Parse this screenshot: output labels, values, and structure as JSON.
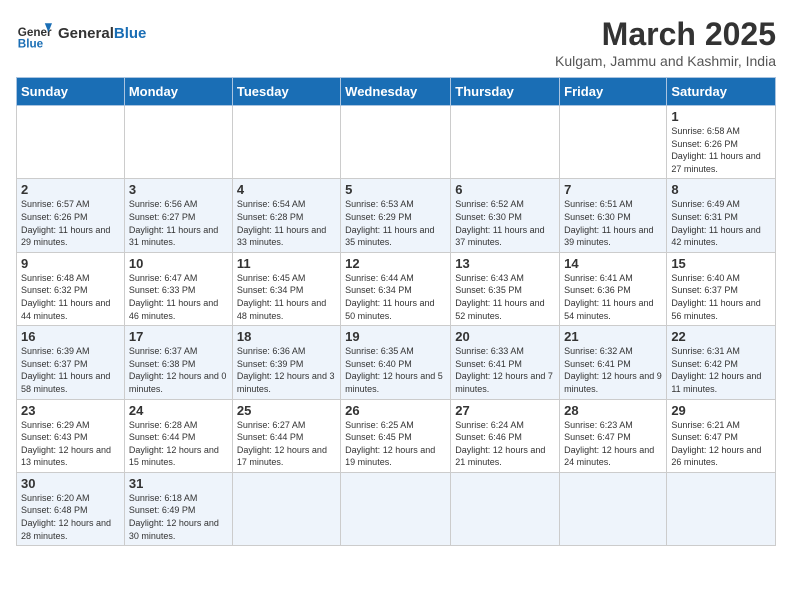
{
  "header": {
    "logo_general": "General",
    "logo_blue": "Blue",
    "month_title": "March 2025",
    "location": "Kulgam, Jammu and Kashmir, India"
  },
  "weekdays": [
    "Sunday",
    "Monday",
    "Tuesday",
    "Wednesday",
    "Thursday",
    "Friday",
    "Saturday"
  ],
  "weeks": [
    [
      {
        "day": "",
        "info": ""
      },
      {
        "day": "",
        "info": ""
      },
      {
        "day": "",
        "info": ""
      },
      {
        "day": "",
        "info": ""
      },
      {
        "day": "",
        "info": ""
      },
      {
        "day": "",
        "info": ""
      },
      {
        "day": "1",
        "info": "Sunrise: 6:58 AM\nSunset: 6:26 PM\nDaylight: 11 hours and 27 minutes."
      }
    ],
    [
      {
        "day": "2",
        "info": "Sunrise: 6:57 AM\nSunset: 6:26 PM\nDaylight: 11 hours and 29 minutes."
      },
      {
        "day": "3",
        "info": "Sunrise: 6:56 AM\nSunset: 6:27 PM\nDaylight: 11 hours and 31 minutes."
      },
      {
        "day": "4",
        "info": "Sunrise: 6:54 AM\nSunset: 6:28 PM\nDaylight: 11 hours and 33 minutes."
      },
      {
        "day": "5",
        "info": "Sunrise: 6:53 AM\nSunset: 6:29 PM\nDaylight: 11 hours and 35 minutes."
      },
      {
        "day": "6",
        "info": "Sunrise: 6:52 AM\nSunset: 6:30 PM\nDaylight: 11 hours and 37 minutes."
      },
      {
        "day": "7",
        "info": "Sunrise: 6:51 AM\nSunset: 6:30 PM\nDaylight: 11 hours and 39 minutes."
      },
      {
        "day": "8",
        "info": "Sunrise: 6:49 AM\nSunset: 6:31 PM\nDaylight: 11 hours and 42 minutes."
      }
    ],
    [
      {
        "day": "9",
        "info": "Sunrise: 6:48 AM\nSunset: 6:32 PM\nDaylight: 11 hours and 44 minutes."
      },
      {
        "day": "10",
        "info": "Sunrise: 6:47 AM\nSunset: 6:33 PM\nDaylight: 11 hours and 46 minutes."
      },
      {
        "day": "11",
        "info": "Sunrise: 6:45 AM\nSunset: 6:34 PM\nDaylight: 11 hours and 48 minutes."
      },
      {
        "day": "12",
        "info": "Sunrise: 6:44 AM\nSunset: 6:34 PM\nDaylight: 11 hours and 50 minutes."
      },
      {
        "day": "13",
        "info": "Sunrise: 6:43 AM\nSunset: 6:35 PM\nDaylight: 11 hours and 52 minutes."
      },
      {
        "day": "14",
        "info": "Sunrise: 6:41 AM\nSunset: 6:36 PM\nDaylight: 11 hours and 54 minutes."
      },
      {
        "day": "15",
        "info": "Sunrise: 6:40 AM\nSunset: 6:37 PM\nDaylight: 11 hours and 56 minutes."
      }
    ],
    [
      {
        "day": "16",
        "info": "Sunrise: 6:39 AM\nSunset: 6:37 PM\nDaylight: 11 hours and 58 minutes."
      },
      {
        "day": "17",
        "info": "Sunrise: 6:37 AM\nSunset: 6:38 PM\nDaylight: 12 hours and 0 minutes."
      },
      {
        "day": "18",
        "info": "Sunrise: 6:36 AM\nSunset: 6:39 PM\nDaylight: 12 hours and 3 minutes."
      },
      {
        "day": "19",
        "info": "Sunrise: 6:35 AM\nSunset: 6:40 PM\nDaylight: 12 hours and 5 minutes."
      },
      {
        "day": "20",
        "info": "Sunrise: 6:33 AM\nSunset: 6:41 PM\nDaylight: 12 hours and 7 minutes."
      },
      {
        "day": "21",
        "info": "Sunrise: 6:32 AM\nSunset: 6:41 PM\nDaylight: 12 hours and 9 minutes."
      },
      {
        "day": "22",
        "info": "Sunrise: 6:31 AM\nSunset: 6:42 PM\nDaylight: 12 hours and 11 minutes."
      }
    ],
    [
      {
        "day": "23",
        "info": "Sunrise: 6:29 AM\nSunset: 6:43 PM\nDaylight: 12 hours and 13 minutes."
      },
      {
        "day": "24",
        "info": "Sunrise: 6:28 AM\nSunset: 6:44 PM\nDaylight: 12 hours and 15 minutes."
      },
      {
        "day": "25",
        "info": "Sunrise: 6:27 AM\nSunset: 6:44 PM\nDaylight: 12 hours and 17 minutes."
      },
      {
        "day": "26",
        "info": "Sunrise: 6:25 AM\nSunset: 6:45 PM\nDaylight: 12 hours and 19 minutes."
      },
      {
        "day": "27",
        "info": "Sunrise: 6:24 AM\nSunset: 6:46 PM\nDaylight: 12 hours and 21 minutes."
      },
      {
        "day": "28",
        "info": "Sunrise: 6:23 AM\nSunset: 6:47 PM\nDaylight: 12 hours and 24 minutes."
      },
      {
        "day": "29",
        "info": "Sunrise: 6:21 AM\nSunset: 6:47 PM\nDaylight: 12 hours and 26 minutes."
      }
    ],
    [
      {
        "day": "30",
        "info": "Sunrise: 6:20 AM\nSunset: 6:48 PM\nDaylight: 12 hours and 28 minutes."
      },
      {
        "day": "31",
        "info": "Sunrise: 6:18 AM\nSunset: 6:49 PM\nDaylight: 12 hours and 30 minutes."
      },
      {
        "day": "",
        "info": ""
      },
      {
        "day": "",
        "info": ""
      },
      {
        "day": "",
        "info": ""
      },
      {
        "day": "",
        "info": ""
      },
      {
        "day": "",
        "info": ""
      }
    ]
  ]
}
